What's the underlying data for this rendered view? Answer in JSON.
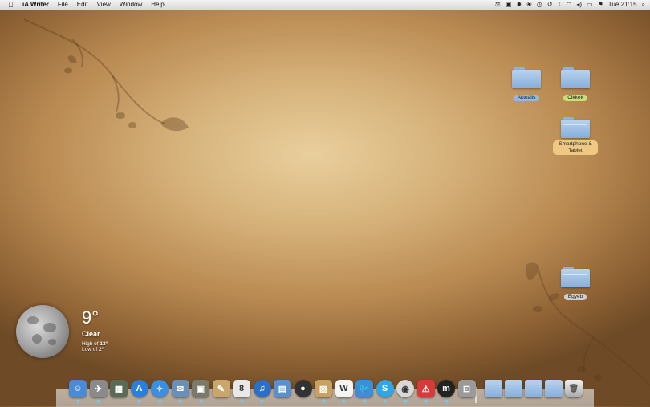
{
  "menubar": {
    "apple_icon": "apple-icon",
    "app_name": "iA Writer",
    "menus": [
      "File",
      "Edit",
      "View",
      "Window",
      "Help"
    ],
    "status_icons": [
      "scale-icon",
      "finder-icon",
      "brightness-icon",
      "paw-icon",
      "clock-icon",
      "timemachine-icon",
      "bluetooth-icon",
      "wifi-icon",
      "volume-icon",
      "battery-icon",
      "flag-icon"
    ],
    "clock": "Tue 21:15",
    "search_icon": "spotlight-icon"
  },
  "desktop": {
    "folders": [
      {
        "label": "Aktuális",
        "color": "#8fbbe8"
      },
      {
        "label": "Cikkek",
        "color": "#c9e07a"
      },
      {
        "label": "Smartphone & Tablet",
        "color": "#f0c783"
      },
      {
        "label": "Egyéb",
        "color": "#cfcfcf"
      }
    ]
  },
  "weather": {
    "temp": "9°",
    "condition": "Clear",
    "high_label": "High of",
    "high": "13°",
    "low_label": "Low of",
    "low": "2°"
  },
  "dock": {
    "apps": [
      {
        "name": "finder",
        "color": "#4a8bd6",
        "glyph": "☺"
      },
      {
        "name": "launchpad",
        "color": "#8a8a8a",
        "glyph": "✈"
      },
      {
        "name": "mission-control",
        "color": "#5a6b55",
        "glyph": "▦"
      },
      {
        "name": "app-store",
        "color": "#2a7fd8",
        "glyph": "A"
      },
      {
        "name": "safari",
        "color": "#3a8fe0",
        "glyph": "✧"
      },
      {
        "name": "mail",
        "color": "#6a8fb8",
        "glyph": "✉"
      },
      {
        "name": "photos",
        "color": "#7a7a6a",
        "glyph": "▣"
      },
      {
        "name": "notes",
        "color": "#c9a76a",
        "glyph": "✎"
      },
      {
        "name": "calendar",
        "color": "#e8e8e8",
        "glyph": "8"
      },
      {
        "name": "itunes",
        "color": "#2a6fc8",
        "glyph": "♫"
      },
      {
        "name": "books",
        "color": "#5a8fd0",
        "glyph": "▤"
      },
      {
        "name": "dvd-player",
        "color": "#333333",
        "glyph": "●"
      },
      {
        "name": "archive-utility",
        "color": "#c8a060",
        "glyph": "▨"
      },
      {
        "name": "ia-writer",
        "color": "#f4f4f4",
        "glyph": "W"
      },
      {
        "name": "twitter",
        "color": "#3a8fd8",
        "glyph": "🐦"
      },
      {
        "name": "skype",
        "color": "#2ea6e8",
        "glyph": "S"
      },
      {
        "name": "chrome",
        "color": "#d8d8d8",
        "glyph": "◉"
      },
      {
        "name": "evernote-badge",
        "color": "#d83a3a",
        "glyph": "⚠"
      },
      {
        "name": "mendeley",
        "color": "#222222",
        "glyph": "m"
      },
      {
        "name": "screenshot",
        "color": "#9a9a9a",
        "glyph": "⊡"
      }
    ],
    "stacks": [
      {
        "name": "applications-stack",
        "color": "#9cc0e6"
      },
      {
        "name": "documents-stack",
        "color": "#9cc0e6"
      },
      {
        "name": "downloads-stack",
        "color": "#9cc0e6"
      },
      {
        "name": "pictures-stack",
        "color": "#9cc0e6"
      }
    ],
    "trash": "trash-icon"
  }
}
